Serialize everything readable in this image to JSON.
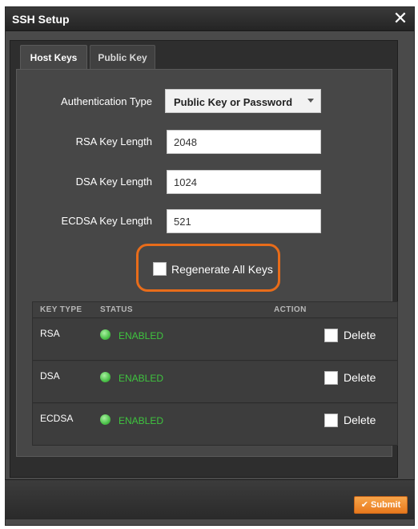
{
  "window": {
    "title": "SSH Setup",
    "close_glyph": "✕"
  },
  "tabs": [
    {
      "label": "Host Keys",
      "active": true
    },
    {
      "label": "Public Key",
      "active": false
    }
  ],
  "form": {
    "auth_type_label": "Authentication Type",
    "auth_type_value": "Public Key or Password",
    "rsa_label": "RSA Key Length",
    "rsa_value": "2048",
    "dsa_label": "DSA Key Length",
    "dsa_value": "1024",
    "ecdsa_label": "ECDSA Key Length",
    "ecdsa_value": "521",
    "regenerate_label": "Regenerate All Keys",
    "regenerate_checked": false
  },
  "keys_table": {
    "columns": [
      "KEY TYPE",
      "STATUS",
      "ACTION"
    ],
    "rows": [
      {
        "type": "RSA",
        "status": "ENABLED",
        "action": "Delete"
      },
      {
        "type": "DSA",
        "status": "ENABLED",
        "action": "Delete"
      },
      {
        "type": "ECDSA",
        "status": "ENABLED",
        "action": "Delete"
      }
    ]
  },
  "footer": {
    "submit_label": "Submit",
    "submit_icon": "checkmark-icon"
  },
  "colors": {
    "accent": "#e86c1a",
    "status_ok": "#3ec43e",
    "dialog_bg": "#4a4a4a"
  }
}
